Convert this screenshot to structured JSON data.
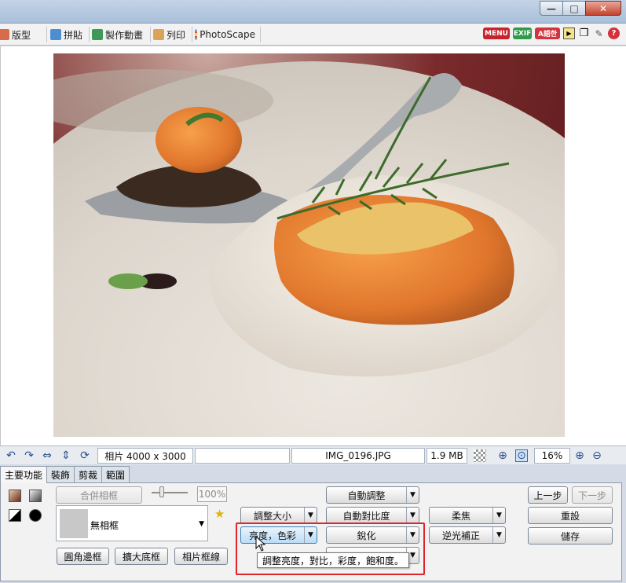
{
  "menu": {
    "tabs": [
      {
        "label": "版型",
        "icon": "template-icon"
      },
      {
        "label": "拼貼",
        "icon": "collage-icon"
      },
      {
        "label": "製作動畫",
        "icon": "gif-icon"
      },
      {
        "label": "列印",
        "icon": "print-icon"
      },
      {
        "label": "PhotoScape",
        "icon": "photoscape-icon"
      }
    ],
    "badges": {
      "menu": "MENU",
      "exif": "EXIF",
      "lang": "A語한"
    }
  },
  "status": {
    "photo_size": "相片 4000 x 3000",
    "filename": "IMG_0196.JPG",
    "filesize": "1.9 MB",
    "zoom": "16%"
  },
  "tabs": [
    "主要功能",
    "裝飾",
    "剪裁",
    "範圍"
  ],
  "panel": {
    "merge_frame": "合併相框",
    "opacity": "100%",
    "frame_name": "無相框",
    "round_corner": "圓角邊框",
    "expand_canvas": "擴大底框",
    "frame_line": "相片框線",
    "resize": "調整大小",
    "brightness_color": "亮度，色彩",
    "auto_adjust": "自動調整",
    "auto_contrast": "自動對比度",
    "sharpen": "銳化",
    "soften": "柔焦",
    "backlight": "逆光補正",
    "undo": "上一步",
    "redo": "下一步",
    "reset": "重設",
    "save": "儲存"
  },
  "tooltip": "調整亮度，對比，彩度，飽和度。"
}
